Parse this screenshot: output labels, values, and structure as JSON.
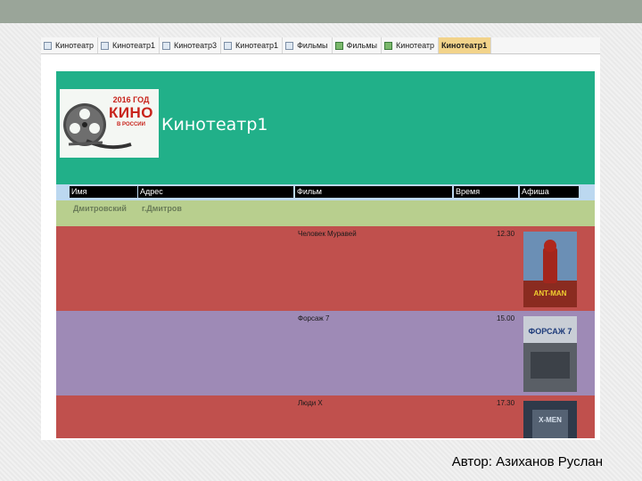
{
  "tabs": [
    {
      "label": "Кинотеатр",
      "icon": "form-icon"
    },
    {
      "label": "Кинотеатр1",
      "icon": "form-icon"
    },
    {
      "label": "Кинотеатр3",
      "icon": "form-icon"
    },
    {
      "label": "Кинотеатр1",
      "icon": "form-icon"
    },
    {
      "label": "Фильмы",
      "icon": "form-icon"
    },
    {
      "label": "Фильмы",
      "icon": "table-icon"
    },
    {
      "label": "Кинотеатр",
      "icon": "table-icon"
    },
    {
      "label": "Кинотеатр1",
      "icon": "report-icon",
      "active": true
    }
  ],
  "report": {
    "title": "Кинотеатр1",
    "logo": {
      "year": "2016 ГОД",
      "main": "КИНО",
      "sub": "В РОССИИ"
    },
    "columns": {
      "name": "Имя",
      "address": "Адрес",
      "film": "Фильм",
      "time": "Время",
      "poster": "Афиша"
    },
    "group": {
      "name": "Дмитровский",
      "address": "г.Дмитров"
    },
    "rows": [
      {
        "film": "Человек Муравей",
        "time": "12.30",
        "color": "#c0504d",
        "poster_title": "ANT-MAN"
      },
      {
        "film": "Форсаж 7",
        "time": "15.00",
        "color": "#9e8ab6",
        "poster_title": "ФОРСАЖ 7"
      },
      {
        "film": "Люди Х",
        "time": "17.30",
        "color": "#c0504d",
        "poster_title": "X-MEN"
      }
    ]
  },
  "author": "Автор: Азиханов Руслан",
  "colors": {
    "header": "#21b089",
    "group": "#b8cf8e",
    "colhead_bg": "#bcd8f0",
    "active_tab": "#f2d38a"
  }
}
